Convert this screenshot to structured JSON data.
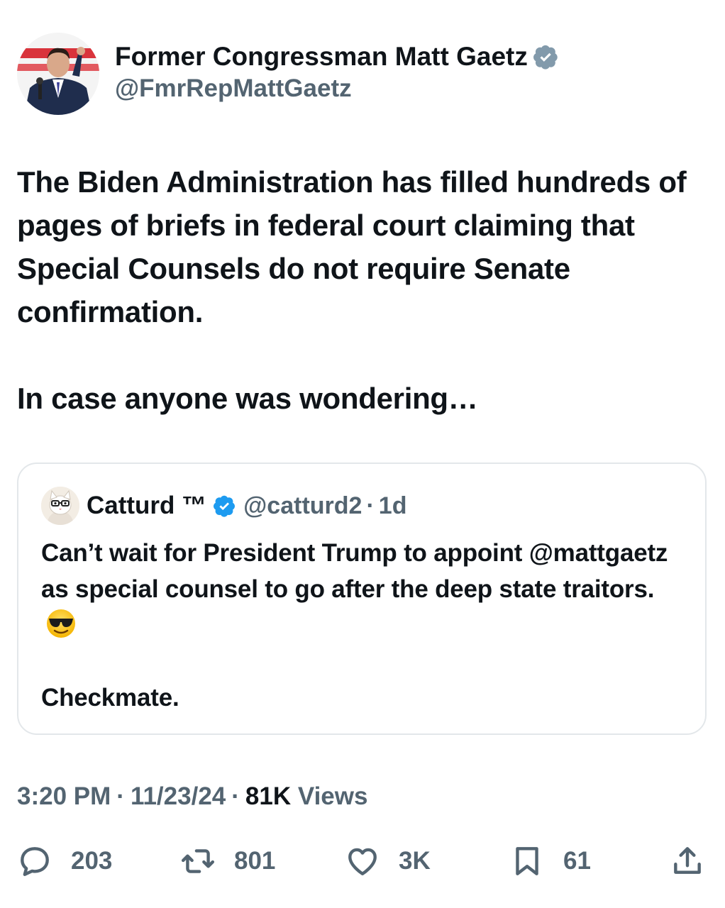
{
  "author": {
    "display_name": "Former Congressman Matt Gaetz",
    "handle": "@FmrRepMattGaetz",
    "verified": true,
    "avatar_icon": "profile-photo"
  },
  "tweet": {
    "paragraphs": [
      "The Biden Administration has filled hundreds of pages of briefs in federal court claiming that Special Counsels do not require Senate confirmation.",
      "In case anyone was wondering…"
    ]
  },
  "quote": {
    "display_name": "Catturd ™",
    "handle": "@catturd2",
    "dot": "·",
    "time": "1d",
    "verified": true,
    "paragraph1": "Can’t wait for President Trump to appoint @mattgaetz as special counsel to go after the deep state traitors.",
    "emoji": "sunglasses-face",
    "paragraph2": "Checkmate."
  },
  "meta": {
    "time": "3:20 PM",
    "date": "11/23/24",
    "views_count": "81K",
    "views_label": "Views",
    "separator": "·"
  },
  "actions": {
    "replies": "203",
    "reposts": "801",
    "likes": "3K",
    "bookmarks": "61"
  },
  "colors": {
    "text": "#0f1419",
    "secondary": "#536471",
    "verified": "#1d9bf0",
    "border": "#e3e7ea"
  }
}
